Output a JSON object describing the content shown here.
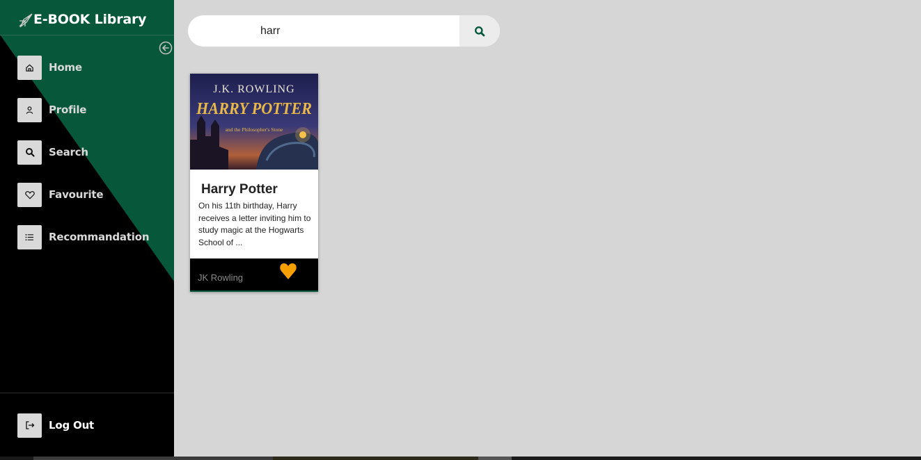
{
  "app": {
    "title": "E-BOOK Library",
    "colors": {
      "brand_green": "#07583a",
      "sidebar_black": "#000000",
      "accent_heart": "#f5a000",
      "background": "#d6d6d6"
    }
  },
  "sidebar": {
    "collapse_icon": "arrow-left-circle-icon",
    "items": [
      {
        "label": "Home",
        "icon": "home-icon"
      },
      {
        "label": "Profile",
        "icon": "user-icon"
      },
      {
        "label": "Search",
        "icon": "search-icon"
      },
      {
        "label": "Favourite",
        "icon": "heart-icon"
      },
      {
        "label": "Recommandation",
        "icon": "list-icon"
      }
    ],
    "logout": {
      "label": "Log Out",
      "icon": "logout-icon"
    }
  },
  "search": {
    "value": "harr",
    "button_icon": "search-icon"
  },
  "results": [
    {
      "cover_author": "J.K. ROWLING",
      "cover_title": "HARRY POTTER",
      "cover_subtitle": "and the Philosopher's Stone",
      "title": "Harry Potter",
      "description": "On his 11th birthday, Harry receives a letter inviting him to study magic at the Hogwarts School of ...",
      "author": "JK Rowling",
      "favourite": true
    }
  ]
}
